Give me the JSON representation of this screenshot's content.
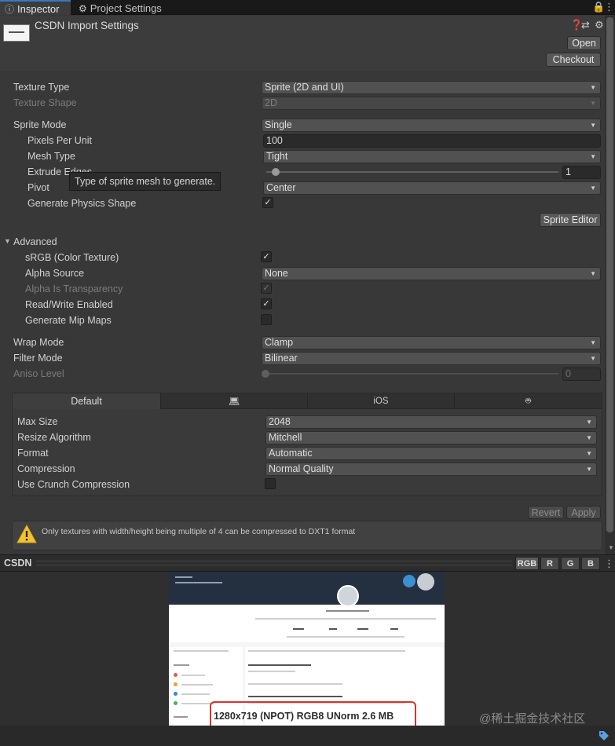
{
  "tabs": [
    {
      "label": "Inspector",
      "icon": "info-icon"
    },
    {
      "label": "Project Settings",
      "icon": "gear-icon"
    }
  ],
  "header": {
    "title": "CSDN Import Settings",
    "open_label": "Open",
    "checkout_label": "Checkout"
  },
  "settings": {
    "texture_type": {
      "label": "Texture Type",
      "value": "Sprite (2D and UI)"
    },
    "texture_shape": {
      "label": "Texture Shape",
      "value": "2D"
    },
    "sprite_mode": {
      "label": "Sprite Mode",
      "value": "Single"
    },
    "pixels_per_unit": {
      "label": "Pixels Per Unit",
      "value": "100"
    },
    "mesh_type": {
      "label": "Mesh Type",
      "value": "Tight"
    },
    "extrude_edges": {
      "label": "Extrude Edges",
      "value": "1",
      "slider_fraction": 0.0
    },
    "pivot": {
      "label": "Pivot",
      "value": "Center"
    },
    "generate_physics_shape": {
      "label": "Generate Physics Shape",
      "checked": true
    },
    "sprite_editor_label": "Sprite Editor",
    "tooltip": "Type of sprite mesh to generate."
  },
  "advanced": {
    "label": "Advanced",
    "srgb": {
      "label": "sRGB (Color Texture)",
      "checked": true
    },
    "alpha_source": {
      "label": "Alpha Source",
      "value": "None"
    },
    "alpha_is_transparency": {
      "label": "Alpha Is Transparency",
      "checked": true
    },
    "read_write": {
      "label": "Read/Write Enabled",
      "checked": true
    },
    "mip_maps": {
      "label": "Generate Mip Maps",
      "checked": false
    }
  },
  "wrap_mode": {
    "label": "Wrap Mode",
    "value": "Clamp"
  },
  "filter_mode": {
    "label": "Filter Mode",
    "value": "Bilinear"
  },
  "aniso_level": {
    "label": "Aniso Level",
    "value": "0",
    "slider_fraction": 0.0
  },
  "platform": {
    "tabs": [
      {
        "label": "Default"
      },
      {
        "label": "",
        "icon": "monitor-icon"
      },
      {
        "label": "iOS"
      },
      {
        "label": "",
        "icon": "android-icon"
      }
    ],
    "max_size": {
      "label": "Max Size",
      "value": "2048"
    },
    "resize_algorithm": {
      "label": "Resize Algorithm",
      "value": "Mitchell"
    },
    "format": {
      "label": "Format",
      "value": "Automatic"
    },
    "compression": {
      "label": "Compression",
      "value": "Normal Quality"
    },
    "crunch": {
      "label": "Use Crunch Compression",
      "checked": false
    }
  },
  "actions": {
    "revert_label": "Revert",
    "apply_label": "Apply"
  },
  "warning": {
    "text": "Only textures with width/height being multiple of 4 can be compressed to DXT1 format",
    "icon": "warning-icon"
  },
  "preview": {
    "title": "CSDN",
    "channels": [
      "RGB",
      "R",
      "G",
      "B"
    ],
    "image_info": "1280x719 (NPOT)  RGB8 UNorm   2.6 MB",
    "watermark": "@稀土掘金技术社区"
  }
}
